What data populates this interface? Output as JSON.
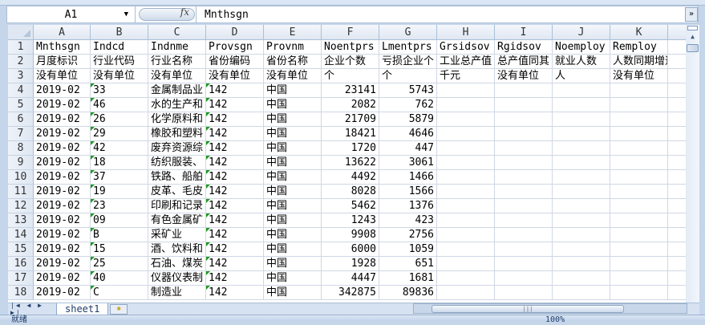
{
  "formula_bar": {
    "name_box": "A1",
    "fx_label": "fx",
    "value": "Mnthsgn",
    "expand_icon": "double-chevron-down"
  },
  "columns": [
    "A",
    "B",
    "C",
    "D",
    "E",
    "F",
    "G",
    "H",
    "I",
    "J",
    "K",
    ""
  ],
  "rows": [
    {
      "n": "1",
      "cells": [
        "Mnthsgn",
        "Indcd",
        "Indnme",
        "Provsgn",
        "Provnm",
        "Noentprs",
        "Lmentprs",
        "Grsidsov",
        "Rgidsov",
        "Noemploy",
        "Remploy",
        ""
      ]
    },
    {
      "n": "2",
      "cells": [
        "月度标识",
        "行业代码",
        "行业名称",
        "省份编码",
        "省份名称",
        "企业个数",
        "亏损企业个",
        "工业总产值",
        "总产值同其",
        "就业人数",
        "人数同期增速",
        ""
      ]
    },
    {
      "n": "3",
      "cells": [
        "没有单位",
        "没有单位",
        "没有单位",
        "没有单位",
        "没有单位",
        "个",
        "个",
        "千元",
        "没有单位",
        "人",
        "没有单位",
        ""
      ]
    },
    {
      "n": "4",
      "cells": [
        "2019-02",
        "33",
        "金属制品业",
        "142",
        "中国",
        "23141",
        "5743",
        "",
        "",
        "",
        "",
        ""
      ]
    },
    {
      "n": "5",
      "cells": [
        "2019-02",
        "46",
        "水的生产和",
        "142",
        "中国",
        "2082",
        "762",
        "",
        "",
        "",
        "",
        ""
      ]
    },
    {
      "n": "6",
      "cells": [
        "2019-02",
        "26",
        "化学原料和",
        "142",
        "中国",
        "21709",
        "5879",
        "",
        "",
        "",
        "",
        ""
      ]
    },
    {
      "n": "7",
      "cells": [
        "2019-02",
        "29",
        "橡胶和塑料",
        "142",
        "中国",
        "18421",
        "4646",
        "",
        "",
        "",
        "",
        ""
      ]
    },
    {
      "n": "8",
      "cells": [
        "2019-02",
        "42",
        "废弃资源综",
        "142",
        "中国",
        "1720",
        "447",
        "",
        "",
        "",
        "",
        ""
      ]
    },
    {
      "n": "9",
      "cells": [
        "2019-02",
        "18",
        "纺织服装、",
        "142",
        "中国",
        "13622",
        "3061",
        "",
        "",
        "",
        "",
        ""
      ]
    },
    {
      "n": "10",
      "cells": [
        "2019-02",
        "37",
        "铁路、船舶",
        "142",
        "中国",
        "4492",
        "1466",
        "",
        "",
        "",
        "",
        ""
      ]
    },
    {
      "n": "11",
      "cells": [
        "2019-02",
        "19",
        "皮革、毛皮",
        "142",
        "中国",
        "8028",
        "1566",
        "",
        "",
        "",
        "",
        ""
      ]
    },
    {
      "n": "12",
      "cells": [
        "2019-02",
        "23",
        "印刷和记录",
        "142",
        "中国",
        "5462",
        "1376",
        "",
        "",
        "",
        "",
        ""
      ]
    },
    {
      "n": "13",
      "cells": [
        "2019-02",
        "09",
        "有色金属矿",
        "142",
        "中国",
        "1243",
        "423",
        "",
        "",
        "",
        "",
        ""
      ]
    },
    {
      "n": "14",
      "cells": [
        "2019-02",
        "B",
        "采矿业",
        "142",
        "中国",
        "9908",
        "2756",
        "",
        "",
        "",
        "",
        ""
      ]
    },
    {
      "n": "15",
      "cells": [
        "2019-02",
        "15",
        "酒、饮料和",
        "142",
        "中国",
        "6000",
        "1059",
        "",
        "",
        "",
        "",
        ""
      ]
    },
    {
      "n": "16",
      "cells": [
        "2019-02",
        "25",
        "石油、煤炭",
        "142",
        "中国",
        "1928",
        "651",
        "",
        "",
        "",
        "",
        ""
      ]
    },
    {
      "n": "17",
      "cells": [
        "2019-02",
        "40",
        "仪器仪表制",
        "142",
        "中国",
        "4447",
        "1681",
        "",
        "",
        "",
        "",
        ""
      ]
    },
    {
      "n": "18",
      "cells": [
        "2019-02",
        "C",
        "制造业",
        "142",
        "中国",
        "342875",
        "89836",
        "",
        "",
        "",
        "",
        ""
      ]
    }
  ],
  "sheet_tabs": [
    {
      "label": "sheet1",
      "active": true
    }
  ],
  "status": {
    "ready": "就绪",
    "zoom": "100%"
  },
  "colors": {
    "accent": "#c5d5ea",
    "error_triangle": "#1e9a1e",
    "grid": "#d0d7e5"
  }
}
